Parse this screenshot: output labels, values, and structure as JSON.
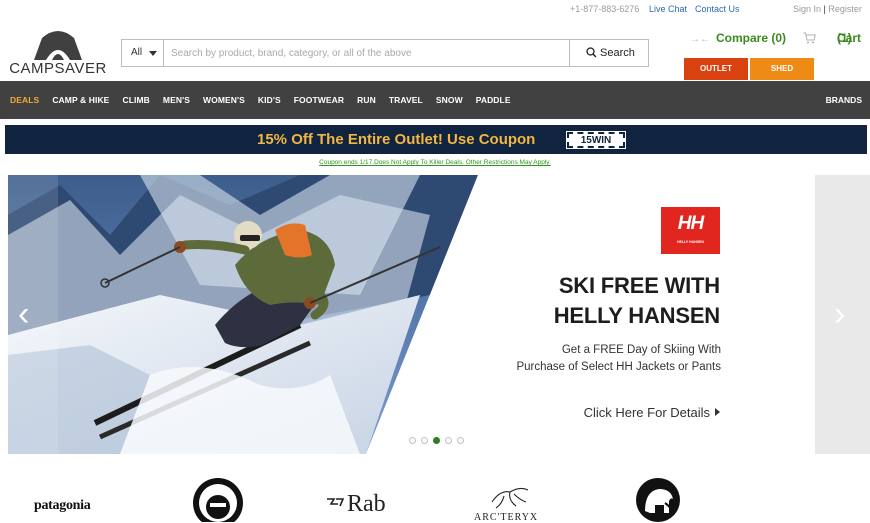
{
  "topbar": {
    "phone": "+1-877-883-6276",
    "live_chat": "Live Chat",
    "contact_us": "Contact Us",
    "sign_in": "Sign In",
    "separator": "|",
    "register": "Register"
  },
  "header": {
    "logo_text": "CAMPSAVER",
    "search_category": "All",
    "search_placeholder": "Search by product, brand, category, or all of the above",
    "search_button": "Search",
    "compare_label": "Compare (0)",
    "cart_label": "Cart",
    "cart_count": "(1)",
    "outlet_button": "OUTLET",
    "shed_button": "SHED"
  },
  "nav": {
    "items": [
      "DEALS",
      "CAMP & HIKE",
      "CLIMB",
      "MEN'S",
      "WOMEN'S",
      "KID'S",
      "FOOTWEAR",
      "RUN",
      "TRAVEL",
      "SNOW",
      "PADDLE"
    ],
    "brands": "BRANDS"
  },
  "promo": {
    "text": "15% Off The Entire Outlet! Use Coupon",
    "code": "15WIN",
    "fine_print": "Coupon ends 1/17.Does Not Apply To Killer Deals. Other Restrictions May Apply."
  },
  "hero": {
    "logo_text": "HH",
    "logo_subtext": "HELLY HANSEN",
    "title_line1": "SKI FREE WITH",
    "title_line2": "HELLY HANSEN",
    "subtitle_line1": "Get a FREE Day of Skiing With",
    "subtitle_line2": "Purchase of Select HH Jackets or Pants",
    "cta": "Click Here For Details",
    "slide_count": 5,
    "active_slide": 3
  },
  "brands": {
    "patagonia": "patagonia",
    "rab": "Rab",
    "arcteryx": "ARC'TERYX"
  },
  "colors": {
    "accent_green": "#3a8a1e",
    "outlet": "#d9410e",
    "shed": "#ed8b16",
    "nav_bg": "#414141",
    "promo_bg": "#10233f",
    "promo_text": "#f3b643"
  }
}
